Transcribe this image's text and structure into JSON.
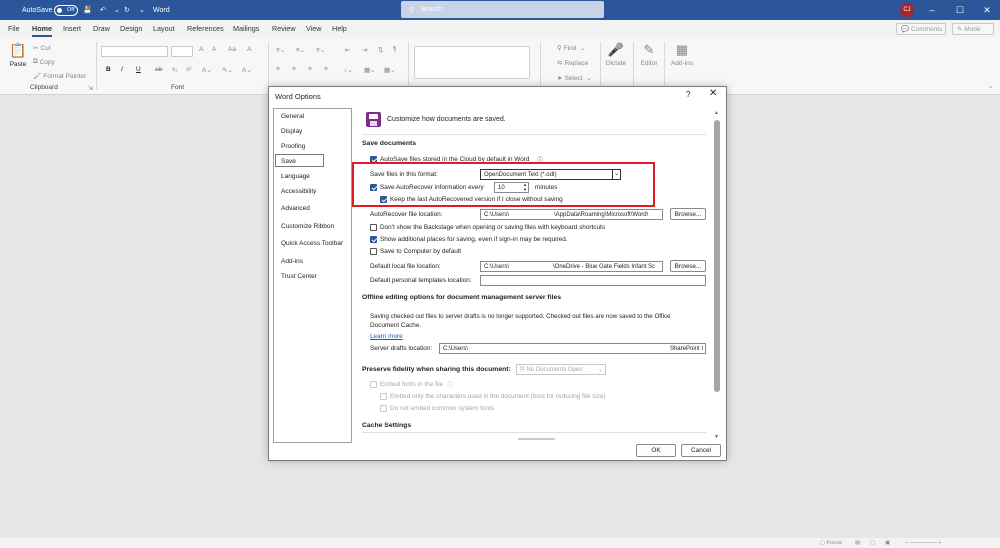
{
  "titlebar": {
    "autosave_label": "AutoSave",
    "autosave_state": "Off",
    "app_name": "Word",
    "search_placeholder": "Search",
    "user_initials": "CJ",
    "accent": "#2b579a"
  },
  "menu": {
    "tabs": [
      "File",
      "Home",
      "Insert",
      "Draw",
      "Design",
      "Layout",
      "References",
      "Mailings",
      "Review",
      "View",
      "Help"
    ],
    "active": "Home",
    "comments": "Comments",
    "mode": "Mode"
  },
  "ribbon": {
    "clipboard": {
      "paste": "Paste",
      "cut": "Cut",
      "copy": "Copy",
      "format_painter": "Format Painter",
      "label": "Clipboard"
    },
    "font": {
      "label": "Font",
      "bold": "B",
      "italic": "I",
      "underline": "U",
      "strike": "ab",
      "subscript": "x₂",
      "superscript": "x²",
      "grow": "A",
      "shrink": "A",
      "case": "Aa",
      "clear": "A"
    },
    "editing": {
      "find": "Find",
      "replace": "Replace",
      "select": "Select"
    },
    "dictate": "Dictate",
    "editor": "Editor",
    "addins": "Add-ins"
  },
  "dialog": {
    "title": "Word Options",
    "help": "?",
    "close": "✕",
    "nav": [
      "General",
      "Display",
      "Proofing",
      "Save",
      "Language",
      "Accessibility",
      "Advanced",
      "Customize Ribbon",
      "Quick Access Toolbar",
      "Add-ins",
      "Trust Center"
    ],
    "nav_selected": "Save",
    "header_text": "Customize how documents are saved.",
    "save_documents": {
      "heading": "Save documents",
      "autosave_cloud": "AutoSave files stored in the Cloud by default in Word",
      "format_label": "Save files in this format:",
      "format_value": "OpenDocument Text (*.odt)",
      "autorecover_label": "Save AutoRecover information every",
      "autorecover_value": "10",
      "minutes": "minutes",
      "keep_last": "Keep the last AutoRecovered version if I close without saving",
      "ar_location_label": "AutoRecover file location:",
      "ar_location_value1": "C:\\Users\\",
      "ar_location_value2": "\\AppData\\Roaming\\Microsoft\\Word\\",
      "browse": "Browse...",
      "dont_show_backstage": "Don't show the Backstage when opening or saving files with keyboard shortcuts",
      "show_additional": "Show additional places for saving, even if sign-in may be required.",
      "save_to_computer": "Save to Computer by default",
      "default_local_label": "Default local file location:",
      "default_local_value1": "C:\\Users\\",
      "default_local_value2": "\\OneDrive - Blue Gate Fields Infant Sc",
      "templates_label": "Default personal templates location:"
    },
    "offline": {
      "heading": "Offline editing options for document management server files",
      "text1": "Saving checked out files to server drafts is no longer supported. Checked out files are now saved to the Office",
      "text2": "Document Cache.",
      "learn_more": "Learn more",
      "drafts_label": "Server drafts location:",
      "drafts_value1": "C:\\Users\\",
      "drafts_value2": "SharePoint I"
    },
    "fidelity": {
      "heading": "Preserve fidelity when sharing this document:",
      "doc_value": "No Documents Open",
      "embed_fonts": "Embed fonts in the file",
      "embed_only": "Embed only the characters used in the document (best for reducing file size)",
      "no_common": "Do not embed common system fonts"
    },
    "cache": {
      "heading": "Cache Settings"
    },
    "ok": "OK",
    "cancel": "Cancel"
  },
  "statusbar": {
    "focus": "Focus"
  }
}
